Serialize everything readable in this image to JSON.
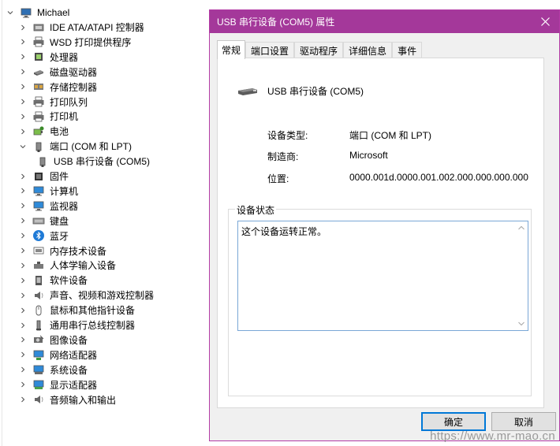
{
  "tree": {
    "root": "Michael",
    "items": [
      {
        "label": "IDE ATA/ATAPI 控制器",
        "icon": "ide-controller-icon",
        "expanded": false
      },
      {
        "label": "WSD 打印提供程序",
        "icon": "printer-icon",
        "expanded": false
      },
      {
        "label": "处理器",
        "icon": "processor-icon",
        "expanded": false
      },
      {
        "label": "磁盘驱动器",
        "icon": "disk-drive-icon",
        "expanded": false
      },
      {
        "label": "存储控制器",
        "icon": "storage-controller-icon",
        "expanded": false
      },
      {
        "label": "打印队列",
        "icon": "print-queue-icon",
        "expanded": false
      },
      {
        "label": "打印机",
        "icon": "printer-icon",
        "expanded": false
      },
      {
        "label": "电池",
        "icon": "battery-icon",
        "expanded": false
      },
      {
        "label": "端口 (COM 和 LPT)",
        "icon": "port-icon",
        "expanded": true
      },
      {
        "label": "USB 串行设备 (COM5)",
        "icon": "usb-serial-icon",
        "child": true
      },
      {
        "label": "固件",
        "icon": "firmware-icon",
        "expanded": false
      },
      {
        "label": "计算机",
        "icon": "computer-icon",
        "expanded": false
      },
      {
        "label": "监视器",
        "icon": "monitor-icon",
        "expanded": false
      },
      {
        "label": "键盘",
        "icon": "keyboard-icon",
        "expanded": false
      },
      {
        "label": "蓝牙",
        "icon": "bluetooth-icon",
        "expanded": false
      },
      {
        "label": "内存技术设备",
        "icon": "memory-device-icon",
        "expanded": false
      },
      {
        "label": "人体学输入设备",
        "icon": "hid-icon",
        "expanded": false
      },
      {
        "label": "软件设备",
        "icon": "software-device-icon",
        "expanded": false
      },
      {
        "label": "声音、视频和游戏控制器",
        "icon": "speaker-icon",
        "expanded": false
      },
      {
        "label": "鼠标和其他指针设备",
        "icon": "mouse-icon",
        "expanded": false
      },
      {
        "label": "通用串行总线控制器",
        "icon": "usb-controller-icon",
        "expanded": false
      },
      {
        "label": "图像设备",
        "icon": "camera-icon",
        "expanded": false
      },
      {
        "label": "网络适配器",
        "icon": "network-adapter-icon",
        "expanded": false
      },
      {
        "label": "系统设备",
        "icon": "system-device-icon",
        "expanded": false
      },
      {
        "label": "显示适配器",
        "icon": "display-adapter-icon",
        "expanded": false
      },
      {
        "label": "音频输入和输出",
        "icon": "audio-io-icon",
        "expanded": false
      }
    ]
  },
  "dialog": {
    "title": "USB 串行设备 (COM5) 属性",
    "close_icon": "close-icon",
    "tabs": [
      "常规",
      "端口设置",
      "驱动程序",
      "详细信息",
      "事件"
    ],
    "active_tab": 0,
    "device_name": "USB 串行设备 (COM5)",
    "props": {
      "type_label": "设备类型:",
      "type_value": "端口 (COM 和 LPT)",
      "mfr_label": "制造商:",
      "mfr_value": "Microsoft",
      "loc_label": "位置:",
      "loc_value": "0000.001d.0000.001.002.000.000.000.000"
    },
    "status_group_label": "设备状态",
    "status_text": "这个设备运转正常。",
    "ok_label": "确定",
    "cancel_label": "取消"
  },
  "watermark": "https://www.mr-mao.cn",
  "colors": {
    "titlebar": "#a4389a",
    "border": "#b33ba5",
    "focus": "#0078d7"
  }
}
